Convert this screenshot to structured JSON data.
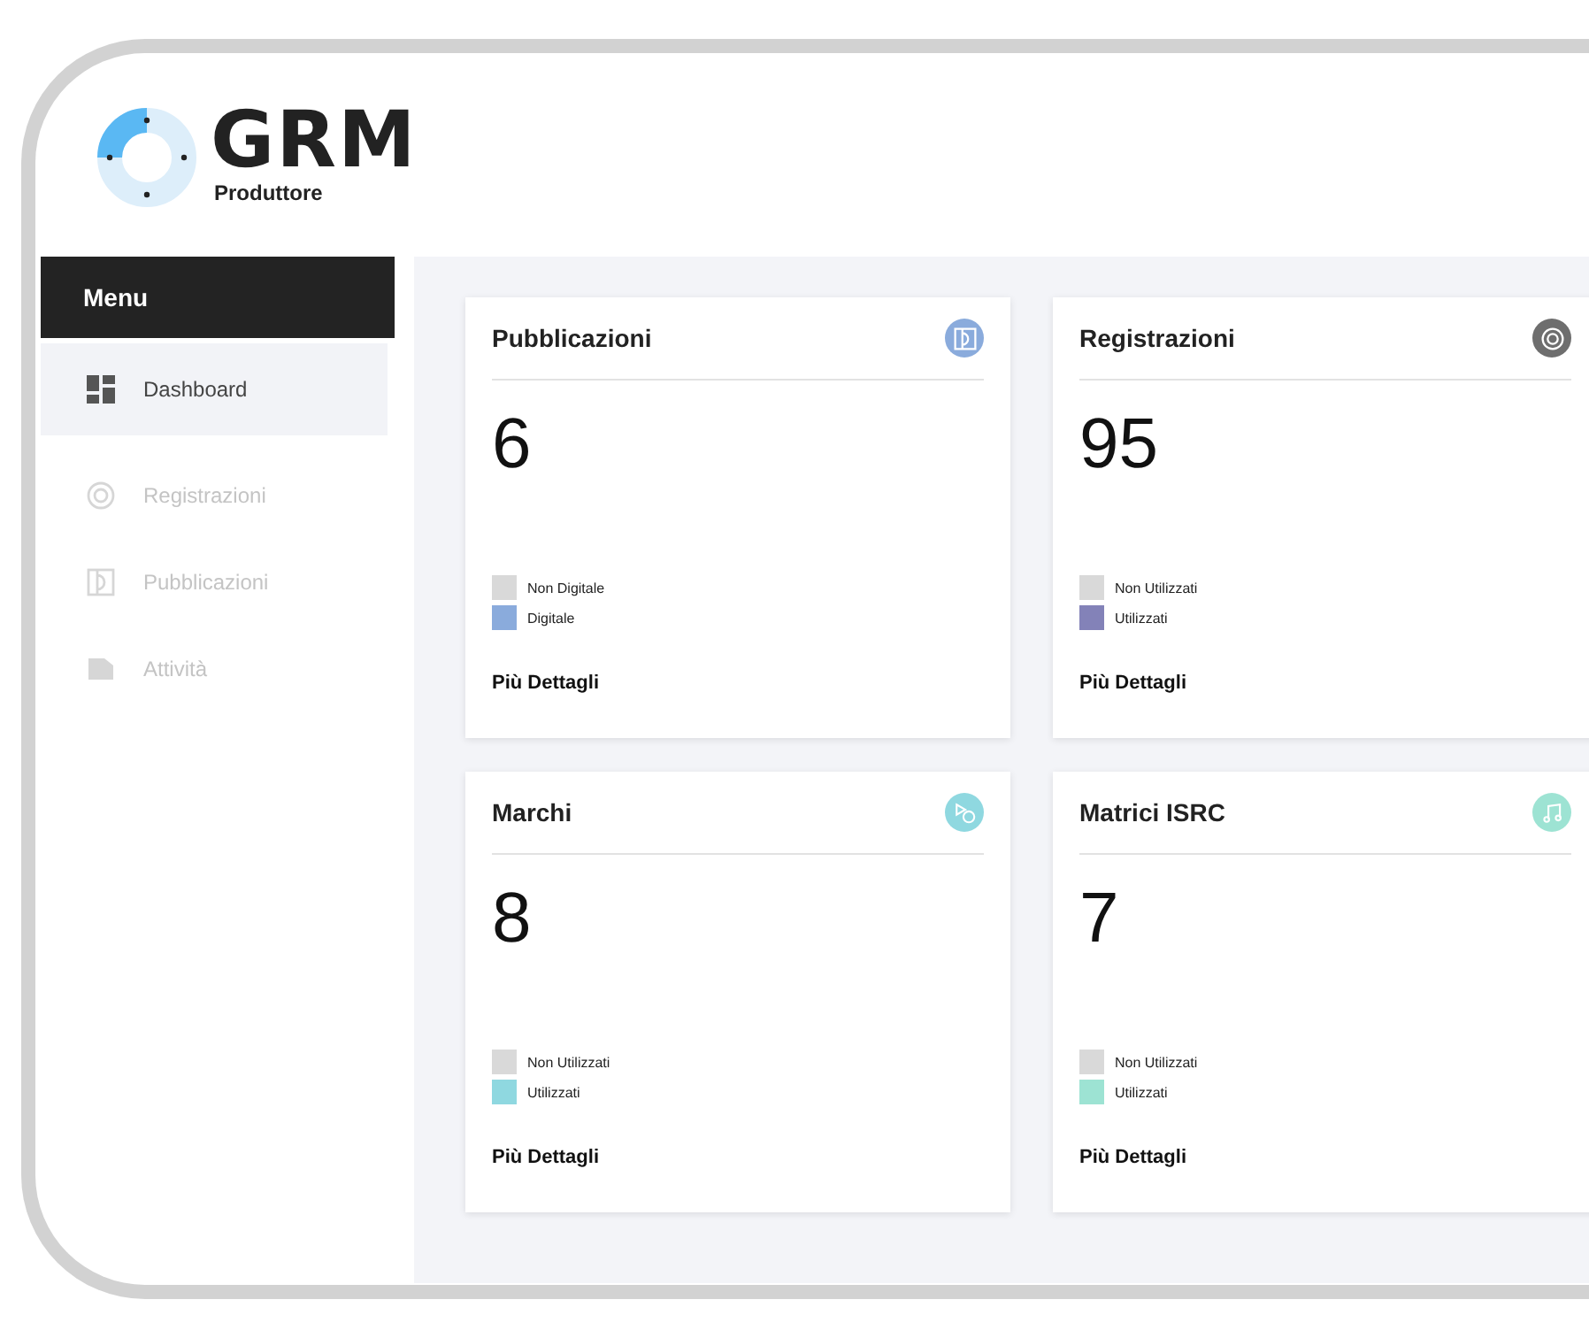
{
  "logo": {
    "name": "GRM",
    "subtitle": "Produttore"
  },
  "menu": {
    "title": "Menu",
    "items": [
      {
        "label": "Dashboard",
        "kind": "dashboard",
        "selected": true
      },
      {
        "label": "Registrazioni",
        "kind": "disc",
        "selected": false
      },
      {
        "label": "Pubblicazioni",
        "kind": "book",
        "selected": false
      },
      {
        "label": "Attività",
        "kind": "folder",
        "selected": false
      }
    ]
  },
  "cards": [
    {
      "title": "Pubblicazioni",
      "kind": "book",
      "color": "#8aabdc",
      "value": "6",
      "legend": [
        {
          "label": "Non Digitale",
          "color": "#d9d9d9"
        },
        {
          "label": "Digitale",
          "color": "#8aabdc"
        }
      ],
      "link": "Più Dettagli"
    },
    {
      "title": "Registrazioni",
      "kind": "disc",
      "color": "#6e6e6e",
      "value": "95",
      "legend": [
        {
          "label": "Non Utilizzati",
          "color": "#d9d9d9"
        },
        {
          "label": "Utilizzati",
          "color": "#8382b8"
        }
      ],
      "link": "Più Dettagli"
    },
    {
      "title": "Marchi",
      "kind": "play",
      "color": "#8fd8e0",
      "value": "8",
      "legend": [
        {
          "label": "Non Utilizzati",
          "color": "#d9d9d9"
        },
        {
          "label": "Utilizzati",
          "color": "#8fd8e0"
        }
      ],
      "link": "Più Dettagli"
    },
    {
      "title": "Matrici ISRC",
      "kind": "music",
      "color": "#9de3d3",
      "value": "7",
      "legend": [
        {
          "label": "Non Utilizzati",
          "color": "#d9d9d9"
        },
        {
          "label": "Utilizzati",
          "color": "#9de3d3"
        }
      ],
      "link": "Più Dettagli"
    }
  ]
}
